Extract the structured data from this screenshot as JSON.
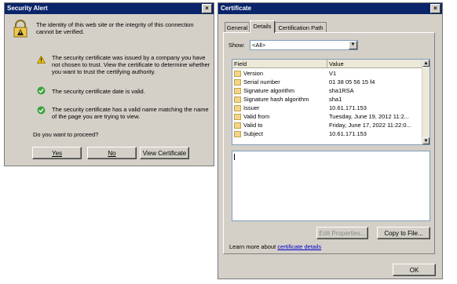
{
  "security_alert": {
    "title": "Security Alert",
    "close": "×",
    "intro": "The identity of this web site or the integrity of this connection cannot be verified.",
    "items": [
      {
        "icon": "warning-icon",
        "text": "The security certificate was issued by a company you have not chosen to trust. View the certificate to determine whether you want to trust the certifying authority."
      },
      {
        "icon": "check-icon",
        "text": "The security certificate date is valid."
      },
      {
        "icon": "check-icon",
        "text": "The security certificate has a valid name matching the name of the page you are trying to view."
      }
    ],
    "question": "Do you want to proceed?",
    "buttons": {
      "yes": "Yes",
      "no": "No",
      "view": "View Certificate"
    }
  },
  "certificate": {
    "title": "Certificate",
    "close": "×",
    "tabs": [
      "General",
      "Details",
      "Certification Path"
    ],
    "show_label": "Show:",
    "show_value": "<All>",
    "columns": {
      "field": "Field",
      "value": "Value"
    },
    "rows": [
      {
        "field": "Version",
        "value": "V1"
      },
      {
        "field": "Serial number",
        "value": "01 38 05 56 15 f4"
      },
      {
        "field": "Signature algorithm",
        "value": "sha1RSA"
      },
      {
        "field": "Signature hash algorithm",
        "value": "sha1"
      },
      {
        "field": "Issuer",
        "value": "10.61.171.153"
      },
      {
        "field": "Valid from",
        "value": "Tuesday, June 19, 2012 11:2..."
      },
      {
        "field": "Valid to",
        "value": "Friday, June 17, 2022 11:22:0..."
      },
      {
        "field": "Subject",
        "value": "10.61.171.153"
      }
    ],
    "edit_properties": "Edit Properties...",
    "copy_to_file": "Copy to File...",
    "learn_more_prefix": "Learn more about",
    "learn_more_link": "certificate details",
    "ok": "OK"
  },
  "colors": {
    "titlebar": "#0a246a",
    "window": "#d4d0c8",
    "link": "#0000cc"
  }
}
